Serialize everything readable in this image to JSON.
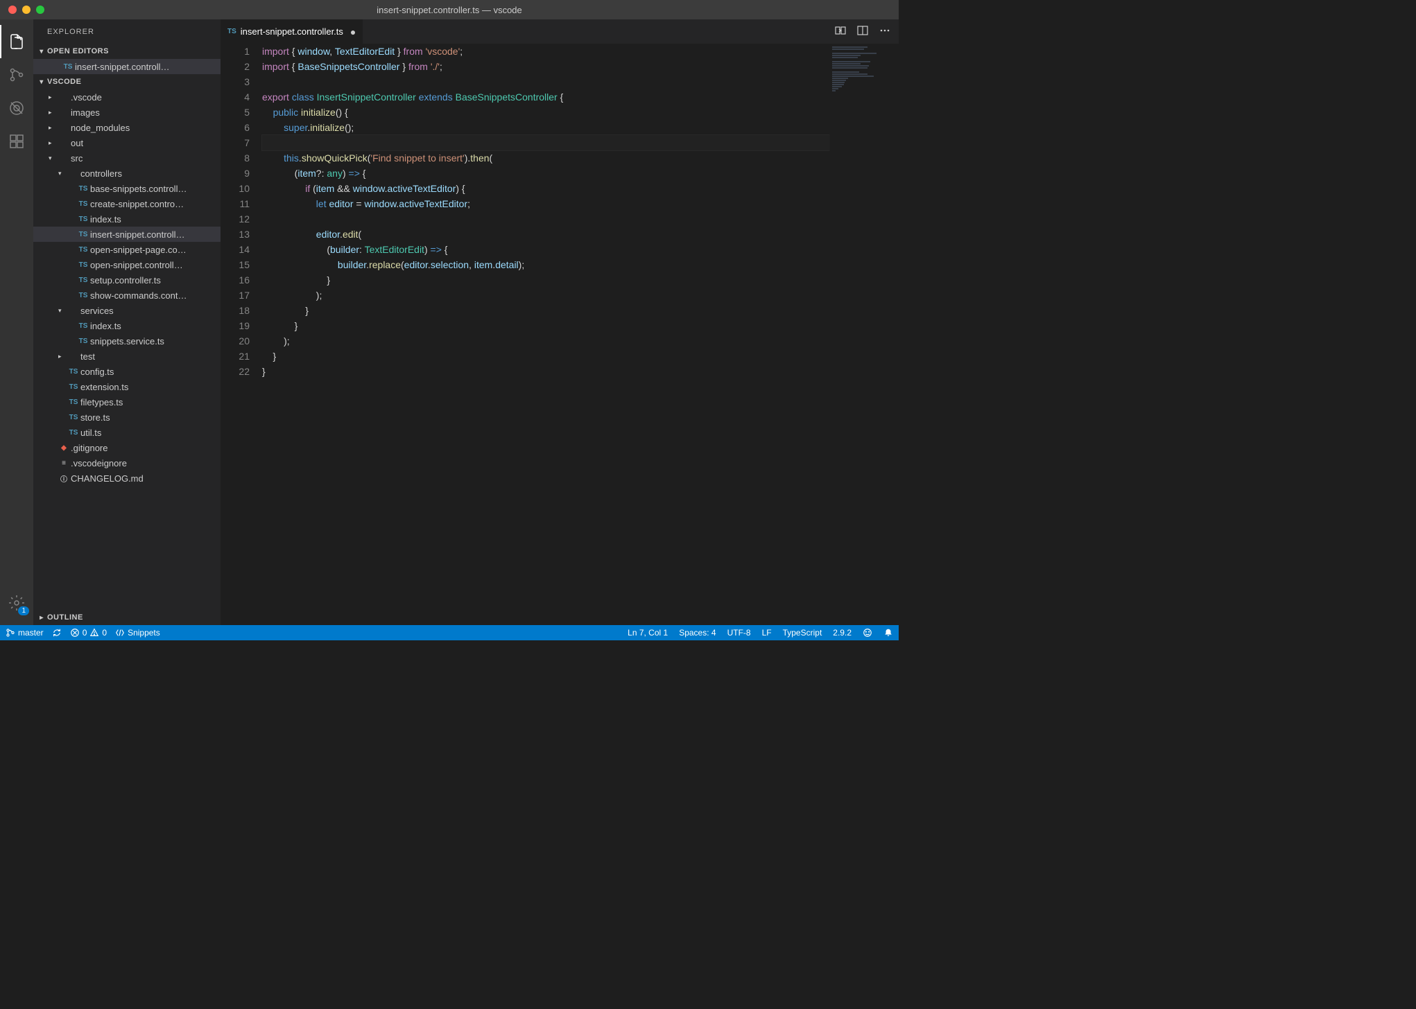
{
  "window": {
    "title": "insert-snippet.controller.ts — vscode"
  },
  "activitybar": {
    "settings_badge": "1"
  },
  "sidebar": {
    "title": "EXPLORER",
    "sections": {
      "open_editors": "OPEN EDITORS",
      "workspace": "VSCODE",
      "outline": "OUTLINE"
    },
    "open_editor_file": "insert-snippet.controll…",
    "tree": [
      {
        "indent": 1,
        "chev": "▸",
        "icon": "",
        "label": ".vscode"
      },
      {
        "indent": 1,
        "chev": "▸",
        "icon": "",
        "label": "images"
      },
      {
        "indent": 1,
        "chev": "▸",
        "icon": "",
        "label": "node_modules"
      },
      {
        "indent": 1,
        "chev": "▸",
        "icon": "",
        "label": "out"
      },
      {
        "indent": 1,
        "chev": "▾",
        "icon": "",
        "label": "src"
      },
      {
        "indent": 2,
        "chev": "▾",
        "icon": "",
        "label": "controllers"
      },
      {
        "indent": 3,
        "chev": "",
        "icon": "TS",
        "label": "base-snippets.controll…"
      },
      {
        "indent": 3,
        "chev": "",
        "icon": "TS",
        "label": "create-snippet.contro…"
      },
      {
        "indent": 3,
        "chev": "",
        "icon": "TS",
        "label": "index.ts"
      },
      {
        "indent": 3,
        "chev": "",
        "icon": "TS",
        "label": "insert-snippet.controll…",
        "active": true
      },
      {
        "indent": 3,
        "chev": "",
        "icon": "TS",
        "label": "open-snippet-page.co…"
      },
      {
        "indent": 3,
        "chev": "",
        "icon": "TS",
        "label": "open-snippet.controll…"
      },
      {
        "indent": 3,
        "chev": "",
        "icon": "TS",
        "label": "setup.controller.ts"
      },
      {
        "indent": 3,
        "chev": "",
        "icon": "TS",
        "label": "show-commands.cont…"
      },
      {
        "indent": 2,
        "chev": "▾",
        "icon": "",
        "label": "services"
      },
      {
        "indent": 3,
        "chev": "",
        "icon": "TS",
        "label": "index.ts"
      },
      {
        "indent": 3,
        "chev": "",
        "icon": "TS",
        "label": "snippets.service.ts"
      },
      {
        "indent": 2,
        "chev": "▸",
        "icon": "",
        "label": "test"
      },
      {
        "indent": 2,
        "chev": "",
        "icon": "TS",
        "label": "config.ts"
      },
      {
        "indent": 2,
        "chev": "",
        "icon": "TS",
        "label": "extension.ts"
      },
      {
        "indent": 2,
        "chev": "",
        "icon": "TS",
        "label": "filetypes.ts"
      },
      {
        "indent": 2,
        "chev": "",
        "icon": "TS",
        "label": "store.ts"
      },
      {
        "indent": 2,
        "chev": "",
        "icon": "TS",
        "label": "util.ts"
      },
      {
        "indent": 1,
        "chev": "",
        "icon": "git",
        "label": ".gitignore"
      },
      {
        "indent": 1,
        "chev": "",
        "icon": "≡",
        "label": ".vscodeignore"
      },
      {
        "indent": 1,
        "chev": "",
        "icon": "ⓘ",
        "label": "CHANGELOG.md"
      }
    ]
  },
  "tab": {
    "icon": "TS",
    "label": "insert-snippet.controller.ts"
  },
  "editor": {
    "line_count": 22,
    "lines": [
      [
        [
          "c-kw",
          "import"
        ],
        [
          "c-punc",
          " { "
        ],
        [
          "c-id",
          "window"
        ],
        [
          "c-punc",
          ", "
        ],
        [
          "c-id",
          "TextEditorEdit"
        ],
        [
          "c-punc",
          " } "
        ],
        [
          "c-kw",
          "from"
        ],
        [
          "c-punc",
          " "
        ],
        [
          "c-str",
          "'vscode'"
        ],
        [
          "c-punc",
          ";"
        ]
      ],
      [
        [
          "c-kw",
          "import"
        ],
        [
          "c-punc",
          " { "
        ],
        [
          "c-id",
          "BaseSnippetsController"
        ],
        [
          "c-punc",
          " } "
        ],
        [
          "c-kw",
          "from"
        ],
        [
          "c-punc",
          " "
        ],
        [
          "c-str",
          "'./'"
        ],
        [
          "c-punc",
          ";"
        ]
      ],
      [],
      [
        [
          "c-kw",
          "export"
        ],
        [
          "c-punc",
          " "
        ],
        [
          "c-type",
          "class"
        ],
        [
          "c-punc",
          " "
        ],
        [
          "c-cls",
          "InsertSnippetController"
        ],
        [
          "c-punc",
          " "
        ],
        [
          "c-type",
          "extends"
        ],
        [
          "c-punc",
          " "
        ],
        [
          "c-cls",
          "BaseSnippetsController"
        ],
        [
          "c-punc",
          " {"
        ]
      ],
      [
        [
          "c-punc",
          "    "
        ],
        [
          "c-type",
          "public"
        ],
        [
          "c-punc",
          " "
        ],
        [
          "c-fn",
          "initialize"
        ],
        [
          "c-punc",
          "() {"
        ]
      ],
      [
        [
          "c-punc",
          "        "
        ],
        [
          "c-this",
          "super"
        ],
        [
          "c-punc",
          "."
        ],
        [
          "c-fn",
          "initialize"
        ],
        [
          "c-punc",
          "();"
        ]
      ],
      [],
      [
        [
          "c-punc",
          "        "
        ],
        [
          "c-this",
          "this"
        ],
        [
          "c-punc",
          "."
        ],
        [
          "c-fn",
          "showQuickPick"
        ],
        [
          "c-punc",
          "("
        ],
        [
          "c-str",
          "'Find snippet to insert'"
        ],
        [
          "c-punc",
          ")."
        ],
        [
          "c-fn",
          "then"
        ],
        [
          "c-punc",
          "("
        ]
      ],
      [
        [
          "c-punc",
          "            ("
        ],
        [
          "c-id",
          "item"
        ],
        [
          "c-punc",
          "?: "
        ],
        [
          "c-cls",
          "any"
        ],
        [
          "c-punc",
          ") "
        ],
        [
          "c-type",
          "=>"
        ],
        [
          "c-punc",
          " {"
        ]
      ],
      [
        [
          "c-punc",
          "                "
        ],
        [
          "c-kw",
          "if"
        ],
        [
          "c-punc",
          " ("
        ],
        [
          "c-id",
          "item"
        ],
        [
          "c-punc",
          " && "
        ],
        [
          "c-id",
          "window"
        ],
        [
          "c-punc",
          "."
        ],
        [
          "c-id",
          "activeTextEditor"
        ],
        [
          "c-punc",
          ") {"
        ]
      ],
      [
        [
          "c-punc",
          "                    "
        ],
        [
          "c-type",
          "let"
        ],
        [
          "c-punc",
          " "
        ],
        [
          "c-id",
          "editor"
        ],
        [
          "c-punc",
          " = "
        ],
        [
          "c-id",
          "window"
        ],
        [
          "c-punc",
          "."
        ],
        [
          "c-id",
          "activeTextEditor"
        ],
        [
          "c-punc",
          ";"
        ]
      ],
      [],
      [
        [
          "c-punc",
          "                    "
        ],
        [
          "c-id",
          "editor"
        ],
        [
          "c-punc",
          "."
        ],
        [
          "c-fn",
          "edit"
        ],
        [
          "c-punc",
          "("
        ]
      ],
      [
        [
          "c-punc",
          "                        ("
        ],
        [
          "c-id",
          "builder"
        ],
        [
          "c-punc",
          ": "
        ],
        [
          "c-cls",
          "TextEditorEdit"
        ],
        [
          "c-punc",
          ") "
        ],
        [
          "c-type",
          "=>"
        ],
        [
          "c-punc",
          " {"
        ]
      ],
      [
        [
          "c-punc",
          "                            "
        ],
        [
          "c-id",
          "builder"
        ],
        [
          "c-punc",
          "."
        ],
        [
          "c-fn",
          "replace"
        ],
        [
          "c-punc",
          "("
        ],
        [
          "c-id",
          "editor"
        ],
        [
          "c-punc",
          "."
        ],
        [
          "c-id",
          "selection"
        ],
        [
          "c-punc",
          ", "
        ],
        [
          "c-id",
          "item"
        ],
        [
          "c-punc",
          "."
        ],
        [
          "c-id",
          "detail"
        ],
        [
          "c-punc",
          ");"
        ]
      ],
      [
        [
          "c-punc",
          "                        }"
        ]
      ],
      [
        [
          "c-punc",
          "                    );"
        ]
      ],
      [
        [
          "c-punc",
          "                }"
        ]
      ],
      [
        [
          "c-punc",
          "            }"
        ]
      ],
      [
        [
          "c-punc",
          "        );"
        ]
      ],
      [
        [
          "c-punc",
          "    }"
        ]
      ],
      [
        [
          "c-punc",
          "}"
        ]
      ]
    ]
  },
  "status": {
    "branch": "master",
    "errors": "0",
    "warnings": "0",
    "snippets": "Snippets",
    "position": "Ln 7, Col 1",
    "spaces": "Spaces: 4",
    "encoding": "UTF-8",
    "eol": "LF",
    "language": "TypeScript",
    "version": "2.9.2"
  }
}
